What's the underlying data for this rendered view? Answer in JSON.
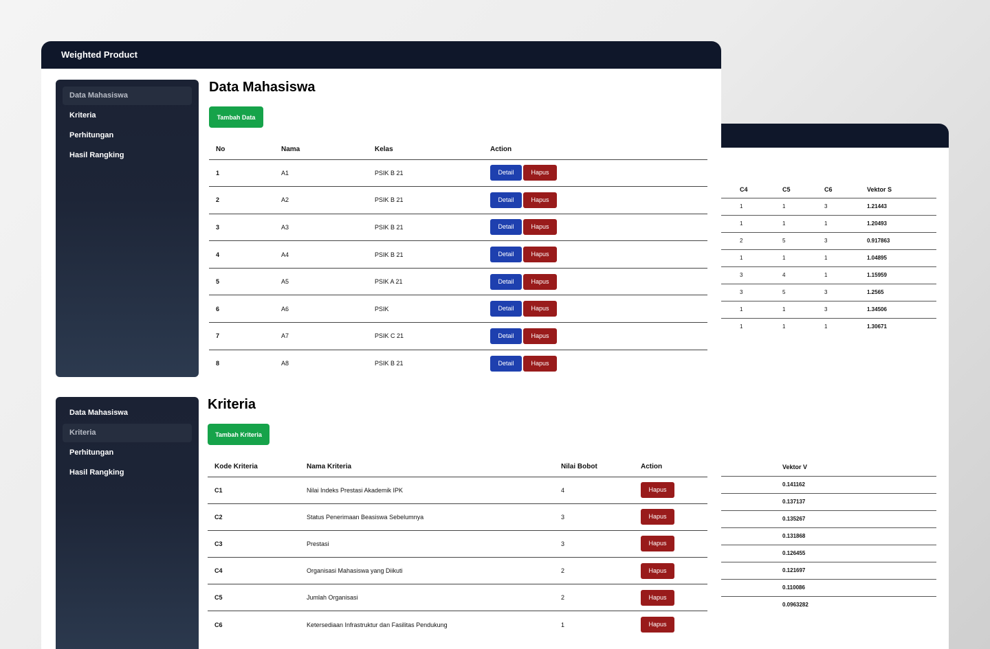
{
  "app_title": "Weighted Product",
  "sidebar": {
    "items": [
      {
        "label": "Data Mahasiswa"
      },
      {
        "label": "Kriteria"
      },
      {
        "label": "Perhitungan"
      },
      {
        "label": "Hasil Rangking"
      }
    ]
  },
  "mahasiswa": {
    "title": "Data Mahasiswa",
    "add_button": "Tambah Data",
    "headers": [
      "No",
      "Nama",
      "Kelas",
      "Action"
    ],
    "detail_label": "Detail",
    "delete_label": "Hapus",
    "rows": [
      {
        "no": "1",
        "nama": "A1",
        "kelas": "PSIK B 21"
      },
      {
        "no": "2",
        "nama": "A2",
        "kelas": "PSIK B 21"
      },
      {
        "no": "3",
        "nama": "A3",
        "kelas": "PSIK B 21"
      },
      {
        "no": "4",
        "nama": "A4",
        "kelas": "PSIK B 21"
      },
      {
        "no": "5",
        "nama": "A5",
        "kelas": "PSIK A 21"
      },
      {
        "no": "6",
        "nama": "A6",
        "kelas": "PSIK"
      },
      {
        "no": "7",
        "nama": "A7",
        "kelas": "PSIK C 21"
      },
      {
        "no": "8",
        "nama": "A8",
        "kelas": "PSIK B 21"
      }
    ]
  },
  "kriteria": {
    "title": "Kriteria",
    "add_button": "Tambah Kriteria",
    "headers": [
      "Kode Kriteria",
      "Nama Kriteria",
      "Nilai Bobot",
      "Action"
    ],
    "delete_label": "Hapus",
    "rows": [
      {
        "kode": "C1",
        "nama": "Nilai Indeks Prestasi Akademik IPK",
        "bobot": "4"
      },
      {
        "kode": "C2",
        "nama": "Status Penerimaan Beasiswa Sebelumnya",
        "bobot": "3"
      },
      {
        "kode": "C3",
        "nama": "Prestasi",
        "bobot": "3"
      },
      {
        "kode": "C4",
        "nama": "Organisasi Mahasiswa yang Diikuti",
        "bobot": "2"
      },
      {
        "kode": "C5",
        "nama": "Jumlah Organisasi",
        "bobot": "2"
      },
      {
        "kode": "C6",
        "nama": "Ketersediaan Infrastruktur dan Fasilitas Pendukung",
        "bobot": "1"
      }
    ]
  },
  "vektor_s": {
    "headers": [
      "C4",
      "C5",
      "C6",
      "Vektor S"
    ],
    "rows": [
      [
        "1",
        "1",
        "3",
        "1.21443"
      ],
      [
        "1",
        "1",
        "1",
        "1.20493"
      ],
      [
        "2",
        "5",
        "3",
        "0.917863"
      ],
      [
        "1",
        "1",
        "1",
        "1.04895"
      ],
      [
        "3",
        "4",
        "1",
        "1.15959"
      ],
      [
        "3",
        "5",
        "3",
        "1.2565"
      ],
      [
        "1",
        "1",
        "3",
        "1.34506"
      ],
      [
        "1",
        "1",
        "1",
        "1.30671"
      ]
    ]
  },
  "vektor_v": {
    "header": "Vektor V",
    "values": [
      "0.141162",
      "0.137137",
      "0.135267",
      "0.131868",
      "0.126455",
      "0.121697",
      "0.110086",
      "0.0963282"
    ]
  }
}
